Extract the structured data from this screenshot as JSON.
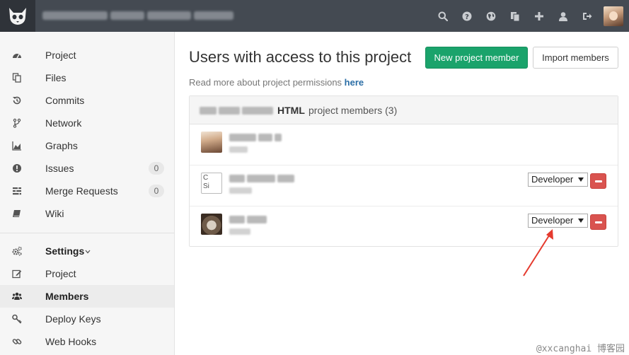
{
  "topbar": {
    "icons": [
      "search-icon",
      "help-icon",
      "globe-icon",
      "copy-icon",
      "plus-icon",
      "user-icon",
      "sign-out-icon"
    ]
  },
  "sidebar": {
    "items": [
      {
        "label": "Project",
        "icon": "dashboard-icon"
      },
      {
        "label": "Files",
        "icon": "files-icon"
      },
      {
        "label": "Commits",
        "icon": "history-icon"
      },
      {
        "label": "Network",
        "icon": "code-fork-icon"
      },
      {
        "label": "Graphs",
        "icon": "area-chart-icon"
      },
      {
        "label": "Issues",
        "icon": "exclamation-circle-icon",
        "count": "0"
      },
      {
        "label": "Merge Requests",
        "icon": "tasks-icon",
        "count": "0"
      },
      {
        "label": "Wiki",
        "icon": "book-icon"
      }
    ],
    "settings": {
      "label": "Settings",
      "items": [
        {
          "label": "Project",
          "icon": "edit-icon"
        },
        {
          "label": "Members",
          "icon": "users-icon",
          "active": true
        },
        {
          "label": "Deploy Keys",
          "icon": "key-icon"
        },
        {
          "label": "Web Hooks",
          "icon": "link-icon"
        }
      ]
    }
  },
  "main": {
    "title": "Users with access to this project",
    "new_member_button": "New project member",
    "import_button": "Import members",
    "help_text": "Read more about project permissions ",
    "help_link": "here",
    "panel": {
      "group_name": "HTML",
      "group_suffix": "project members (3)"
    },
    "members": [
      {
        "avatar": "girl"
      },
      {
        "avatar": "broken",
        "role": "Developer"
      },
      {
        "avatar": "cat",
        "role": "Developer"
      }
    ]
  },
  "watermark": "@xxcanghai 博客园",
  "colors": {
    "topbar": "#444a52",
    "primary_green": "#1aa36b",
    "danger_red": "#d9534f",
    "link_blue": "#2b6ea6"
  }
}
